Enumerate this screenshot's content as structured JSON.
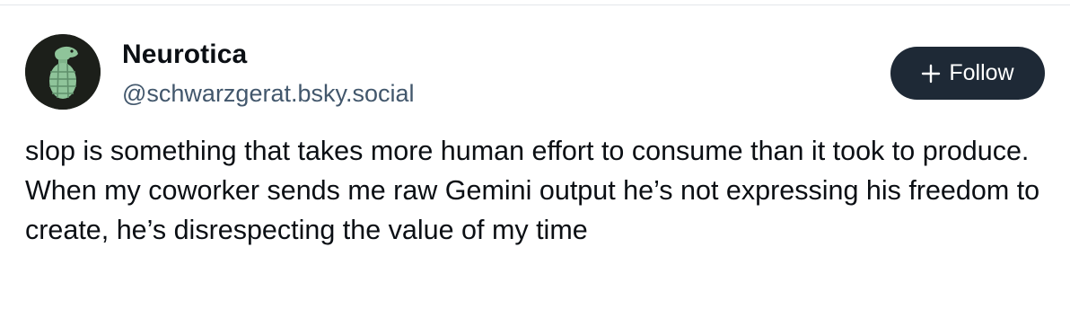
{
  "post": {
    "author": {
      "display_name": "Neurotica",
      "handle": "@schwarzgerat.bsky.social",
      "avatar_icon": "grenade-avatar-icon"
    },
    "follow_button": {
      "label": "Follow",
      "icon": "plus-icon"
    },
    "text": "slop is something that takes more human effort to consume than it took to produce. When my coworker sends me raw Gemini output he’s not expressing his freedom to create, he’s disrespecting the value of my time"
  },
  "colors": {
    "text_primary": "#0b0f14",
    "text_secondary": "#42576c",
    "follow_button_bg": "#1e2936",
    "avatar_bg": "#1c1f1a",
    "avatar_figure": "#8fc49a"
  }
}
